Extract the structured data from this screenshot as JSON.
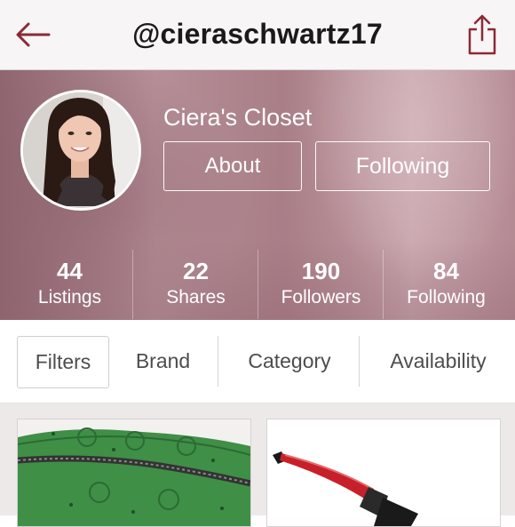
{
  "navbar": {
    "back_icon": "arrow-left-icon",
    "title": "@cieraschwartz17",
    "share_icon": "share-icon",
    "accent_color": "#8b2a36"
  },
  "profile": {
    "closet_name": "Ciera's Closet",
    "about_label": "About",
    "following_label": "Following",
    "avatar": "profile-photo"
  },
  "stats": [
    {
      "number": "44",
      "label": "Listings"
    },
    {
      "number": "22",
      "label": "Shares"
    },
    {
      "number": "190",
      "label": "Followers"
    },
    {
      "number": "84",
      "label": "Following"
    }
  ],
  "filters": {
    "filters_label": "Filters",
    "brand_label": "Brand",
    "category_label": "Category",
    "availability_label": "Availability"
  },
  "listings": [
    {
      "thumbnail": "green-zip-pouch"
    },
    {
      "thumbnail": "red-curling-wand"
    }
  ]
}
